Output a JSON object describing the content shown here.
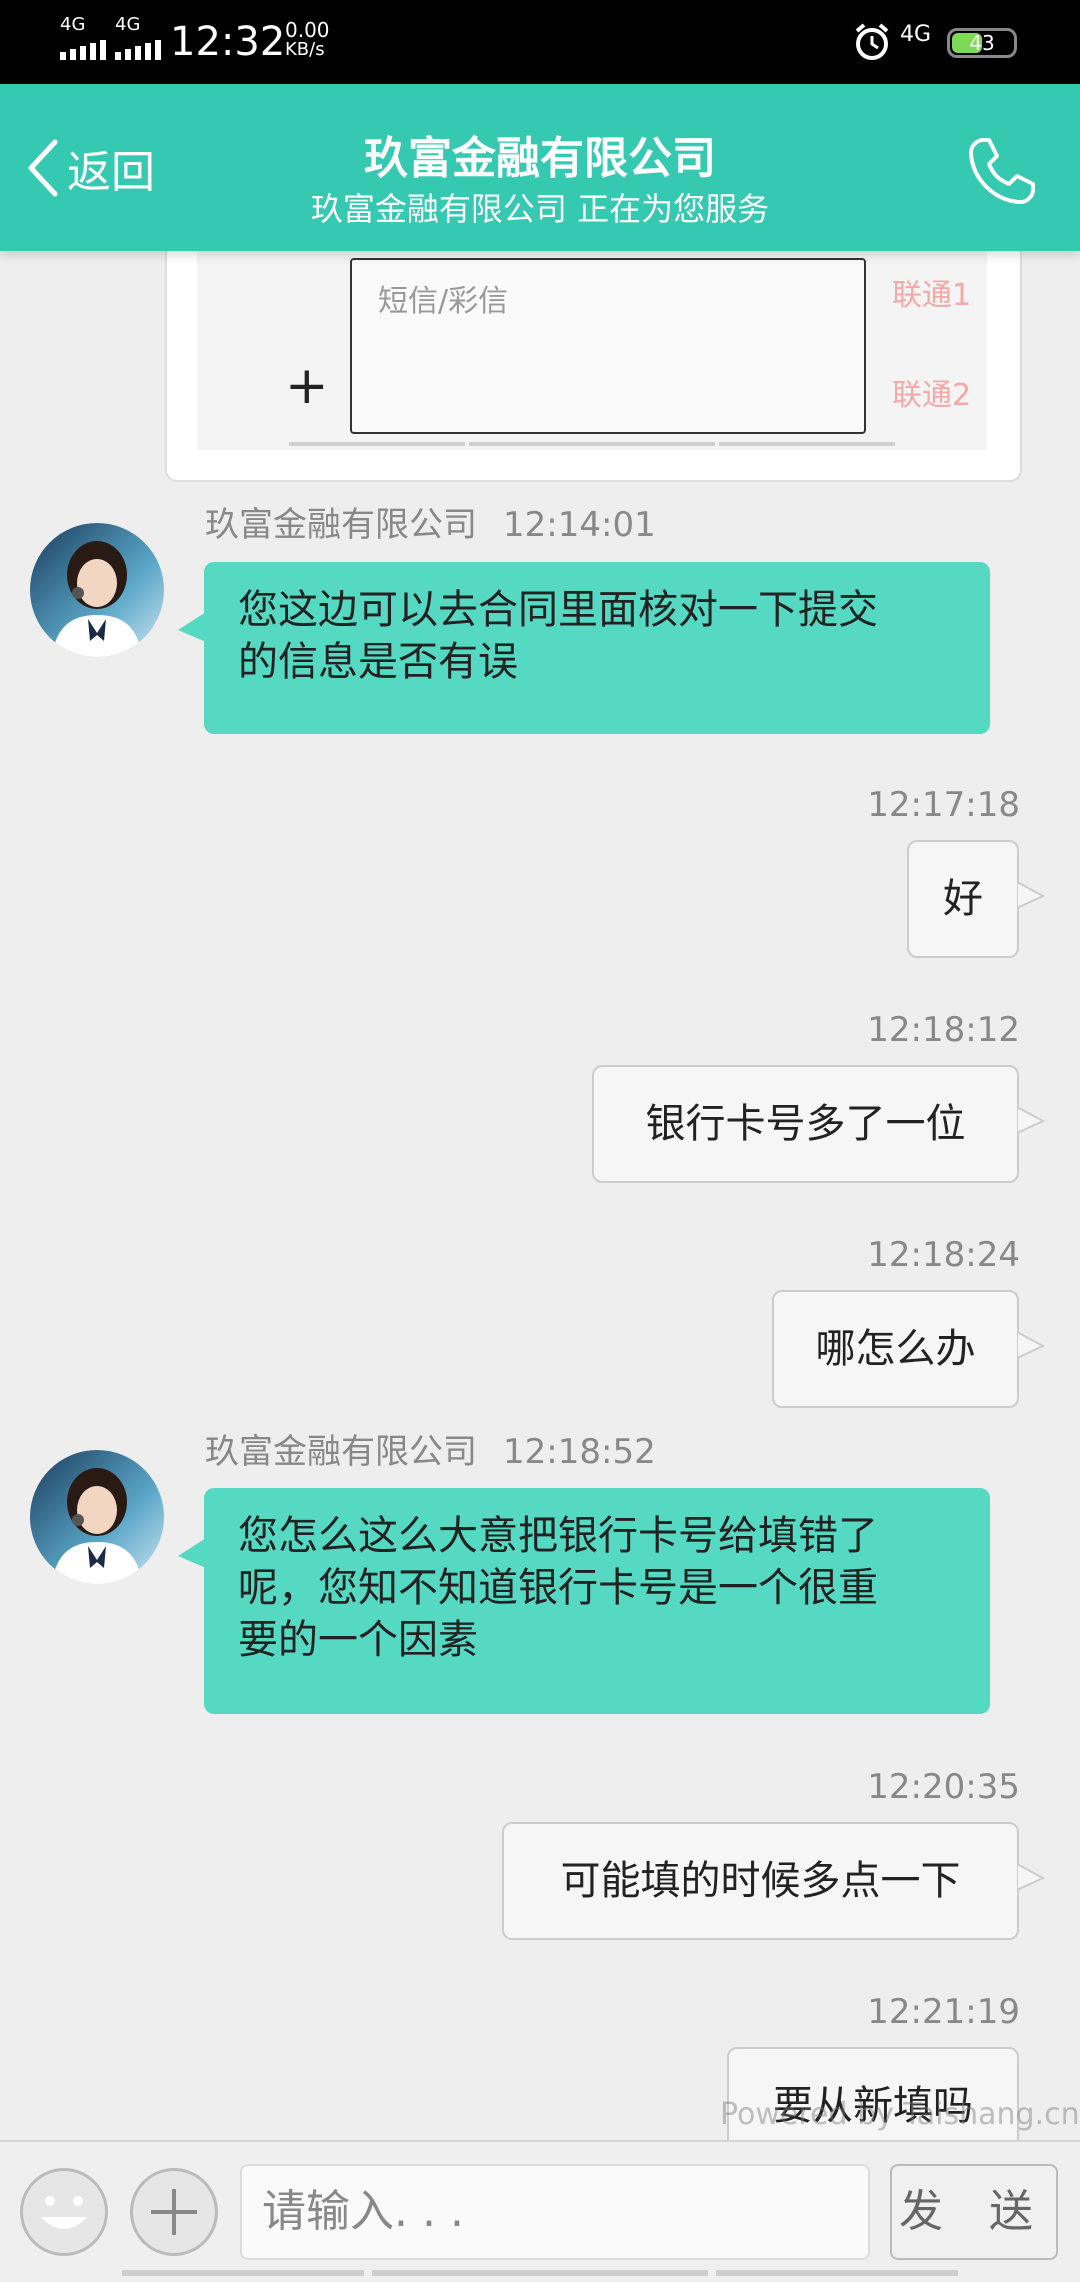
{
  "status_bar": {
    "network_left_1": "4G",
    "network_left_2": "4G",
    "time": "12:32",
    "speed_value": "0.00",
    "speed_unit": "KB/s",
    "network_right": "4G",
    "battery": "43"
  },
  "header": {
    "back_label": "返回",
    "title": "玖富金融有限公司",
    "subtitle": "玖富金融有限公司 正在为您服务"
  },
  "sms_card": {
    "placeholder": "短信/彩信",
    "sim1": "联通1",
    "sim2": "联通2"
  },
  "messages": [
    {
      "direction": "in",
      "sender": "玖富金融有限公司",
      "time": "12:14:01",
      "lines": [
        "您这边可以去合同里面核对一下提交",
        "的信息是否有误"
      ]
    },
    {
      "direction": "out",
      "time": "12:17:18",
      "text": "好"
    },
    {
      "direction": "out",
      "time": "12:18:12",
      "text": "银行卡号多了一位"
    },
    {
      "direction": "out",
      "time": "12:18:24",
      "text": "哪怎么办"
    },
    {
      "direction": "in",
      "sender": "玖富金融有限公司",
      "time": "12:18:52",
      "lines": [
        "您怎么这么大意把银行卡号给填错了",
        "呢，您知不知道银行卡号是一个很重",
        "要的一个因素"
      ]
    },
    {
      "direction": "out",
      "time": "12:20:35",
      "text": "可能填的时候多点一下"
    },
    {
      "direction": "out",
      "time": "12:21:19",
      "text": "要从新填吗"
    }
  ],
  "input": {
    "placeholder": "请输入. . .",
    "send_label": "发 送"
  },
  "watermark": "Powered by Taishang.cn",
  "colors": {
    "header": "#36c9b2",
    "incoming_bubble": "#55d9c3",
    "outgoing_bubble": "#f6f6f6"
  }
}
